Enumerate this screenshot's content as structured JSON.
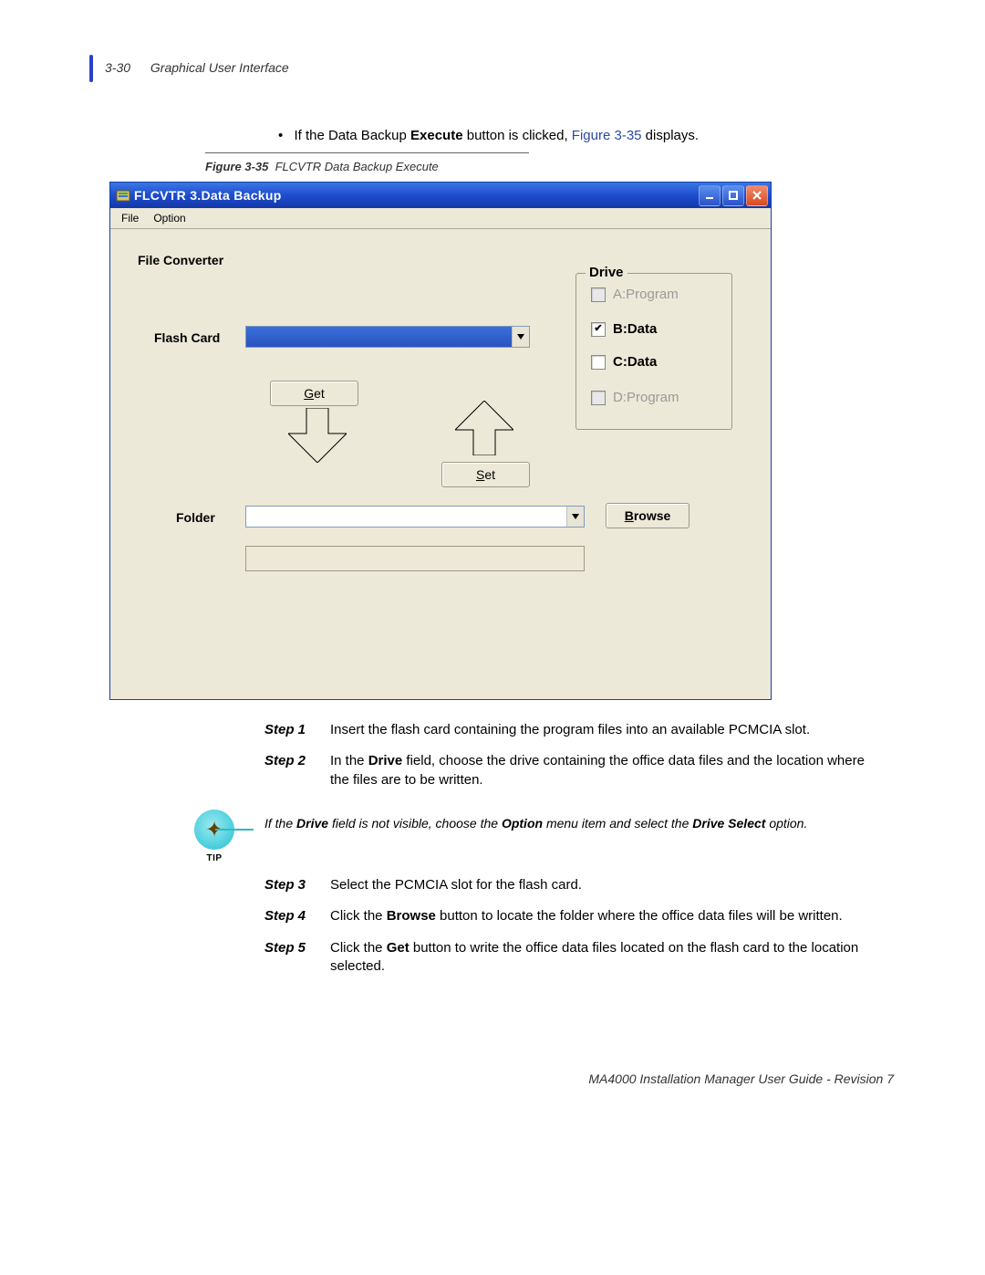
{
  "header": {
    "page_number": "3-30",
    "section": "Graphical User Interface"
  },
  "bullet": {
    "prefix": "If the Data Backup ",
    "bold": "Execute",
    "mid": " button is clicked, ",
    "link": "Figure 3-35",
    "suffix": " displays."
  },
  "figure": {
    "label": "Figure 3-35",
    "caption": "FLCVTR Data Backup Execute"
  },
  "window": {
    "title": "FLCVTR  3.Data Backup",
    "menus": [
      "File",
      "Option"
    ],
    "labels": {
      "file_converter": "File Converter",
      "flash_card": "Flash Card",
      "folder": "Folder"
    },
    "buttons": {
      "get": "Get",
      "set": "Set",
      "browse": "Browse"
    },
    "drive": {
      "legend": "Drive",
      "options": [
        {
          "label": "A:Program",
          "checked": false,
          "enabled": false
        },
        {
          "label": "B:Data",
          "checked": true,
          "enabled": true
        },
        {
          "label": "C:Data",
          "checked": false,
          "enabled": true
        },
        {
          "label": "D:Program",
          "checked": false,
          "enabled": false
        }
      ]
    }
  },
  "steps_block1": [
    {
      "label": "Step 1",
      "text_parts": [
        {
          "t": "Insert the flash card containing the program files into an available PCMCIA slot."
        }
      ]
    },
    {
      "label": "Step 2",
      "text_parts": [
        {
          "t": "In the "
        },
        {
          "t": "Drive",
          "b": true
        },
        {
          "t": " field, choose the drive containing the office data files and the location where the files are to be written."
        }
      ]
    }
  ],
  "tip": {
    "label": "TIP",
    "text_parts": [
      {
        "t": "If the "
      },
      {
        "t": "Drive",
        "b": true
      },
      {
        "t": " field is not visible, choose the "
      },
      {
        "t": "Option",
        "b": true
      },
      {
        "t": " menu item and select the "
      },
      {
        "t": "Drive Select",
        "b": true
      },
      {
        "t": " option."
      }
    ]
  },
  "steps_block2": [
    {
      "label": "Step 3",
      "text_parts": [
        {
          "t": "Select the PCMCIA slot for the flash card."
        }
      ]
    },
    {
      "label": "Step 4",
      "text_parts": [
        {
          "t": "Click the "
        },
        {
          "t": "Browse",
          "b": true
        },
        {
          "t": " button to locate the folder where the office data files will be written."
        }
      ]
    },
    {
      "label": "Step 5",
      "text_parts": [
        {
          "t": "Click the "
        },
        {
          "t": "Get",
          "b": true
        },
        {
          "t": " button to write the office data files located on the flash card to the location selected."
        }
      ]
    }
  ],
  "footer": "MA4000 Installation Manager User Guide - Revision 7"
}
